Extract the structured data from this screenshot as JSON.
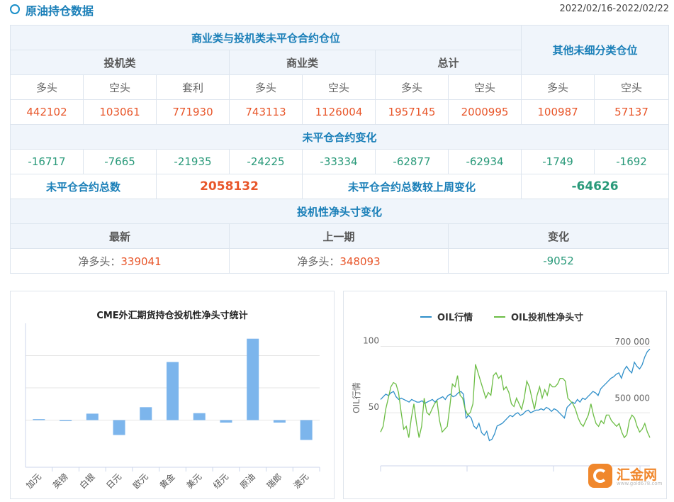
{
  "header": {
    "title": "原油持仓数据",
    "date_range": "2022/02/16-2022/02/22"
  },
  "table": {
    "section_commercial_speculative": "商业类与投机类未平仓合约仓位",
    "section_other": "其他未细分类仓位",
    "group_speculative": "投机类",
    "group_commercial": "商业类",
    "group_total": "总计",
    "col_long": "多头",
    "col_short": "空头",
    "col_spread": "套利",
    "positions": [
      "442102",
      "103061",
      "771930",
      "743113",
      "1126004",
      "1957145",
      "2000995",
      "100987",
      "57137"
    ],
    "section_change": "未平仓合约变化",
    "changes": [
      "-16717",
      "-7665",
      "-21935",
      "-24225",
      "-33334",
      "-62877",
      "-62934",
      "-1749",
      "-1692"
    ],
    "total_oi_label": "未平仓合约总数",
    "total_oi_value": "2058132",
    "total_oi_change_label": "未平仓合约总数较上周变化",
    "total_oi_change_value": "-64626",
    "section_net": "投机性净头寸变化",
    "net_latest_label": "最新",
    "net_prev_label": "上一期",
    "net_change_label": "变化",
    "net_long_prefix": "净多头：",
    "net_latest_value": "339041",
    "net_prev_value": "348093",
    "net_change_value": "-9052"
  },
  "chart_data": [
    {
      "type": "bar",
      "title": "CME外汇期货持仓投机性净头寸统计",
      "categories": [
        "加元",
        "英镑",
        "白银",
        "日元",
        "欧元",
        "黄金",
        "美元",
        "纽元",
        "原油",
        "瑞郎",
        "澳元"
      ],
      "values": [
        2,
        -2,
        13,
        -30,
        26,
        117,
        14,
        -5,
        164,
        -5,
        -40
      ],
      "ylim": [
        -95,
        195
      ],
      "bar_color": "#7cb5ec"
    },
    {
      "type": "line",
      "series": [
        {
          "name": "OIL行情",
          "color": "#2f8fc9",
          "axis": "left",
          "values": [
            60,
            62,
            64,
            63,
            65,
            66,
            62,
            60,
            61,
            60,
            59,
            58,
            60,
            59,
            58,
            58,
            59,
            57,
            58,
            59,
            60,
            58,
            60,
            61,
            62,
            60,
            63,
            64,
            62,
            63,
            65,
            66,
            64,
            46,
            48,
            46,
            40,
            38,
            42,
            35,
            33,
            36,
            29,
            30,
            34,
            40,
            41,
            42,
            44,
            46,
            48,
            47,
            49,
            50,
            48,
            49,
            51,
            52,
            50,
            51,
            52,
            52,
            53,
            52,
            54,
            53,
            51,
            53,
            52,
            50,
            48,
            46,
            54,
            56,
            58,
            57,
            60,
            58,
            61,
            60,
            62,
            64,
            66,
            65,
            63,
            68,
            70,
            72,
            74,
            76,
            77,
            79,
            80,
            76,
            82,
            85,
            82,
            80,
            88,
            85,
            83,
            86,
            92,
            96,
            98
          ]
        },
        {
          "name": "OIL投机性净头寸",
          "color": "#6cbd45",
          "axis": "right",
          "values": [
            400,
            420,
            480,
            520,
            560,
            575,
            570,
            540,
            470,
            410,
            420,
            380,
            450,
            500,
            430,
            380,
            420,
            520,
            470,
            460,
            480,
            500,
            510,
            440,
            400,
            410,
            420,
            490,
            570,
            560,
            600,
            530,
            520,
            480,
            460,
            470,
            500,
            640,
            610,
            580,
            550,
            520,
            540,
            530,
            600,
            610,
            590,
            600,
            550,
            560,
            540,
            500,
            490,
            520,
            500,
            480,
            520,
            580,
            560,
            520,
            480,
            530,
            560,
            520,
            550,
            530,
            570,
            560,
            560,
            570,
            590,
            590,
            580,
            520,
            510,
            500,
            480,
            450,
            430,
            420,
            440,
            460,
            500,
            460,
            430,
            420,
            440,
            430,
            460,
            460,
            440,
            430,
            420,
            430,
            400,
            380,
            390,
            440,
            460,
            450,
            420,
            400,
            410,
            430,
            400,
            380
          ]
        }
      ],
      "ylabel": "OIL行情",
      "left_ticks": [
        "100",
        "50"
      ],
      "right_ticks": [
        "700 000",
        "500 000"
      ],
      "left_ylim": [
        10,
        112
      ],
      "right_ylim": [
        280,
        760
      ]
    }
  ],
  "watermark": {
    "name": "汇金网",
    "url": "www.gold678.com"
  }
}
